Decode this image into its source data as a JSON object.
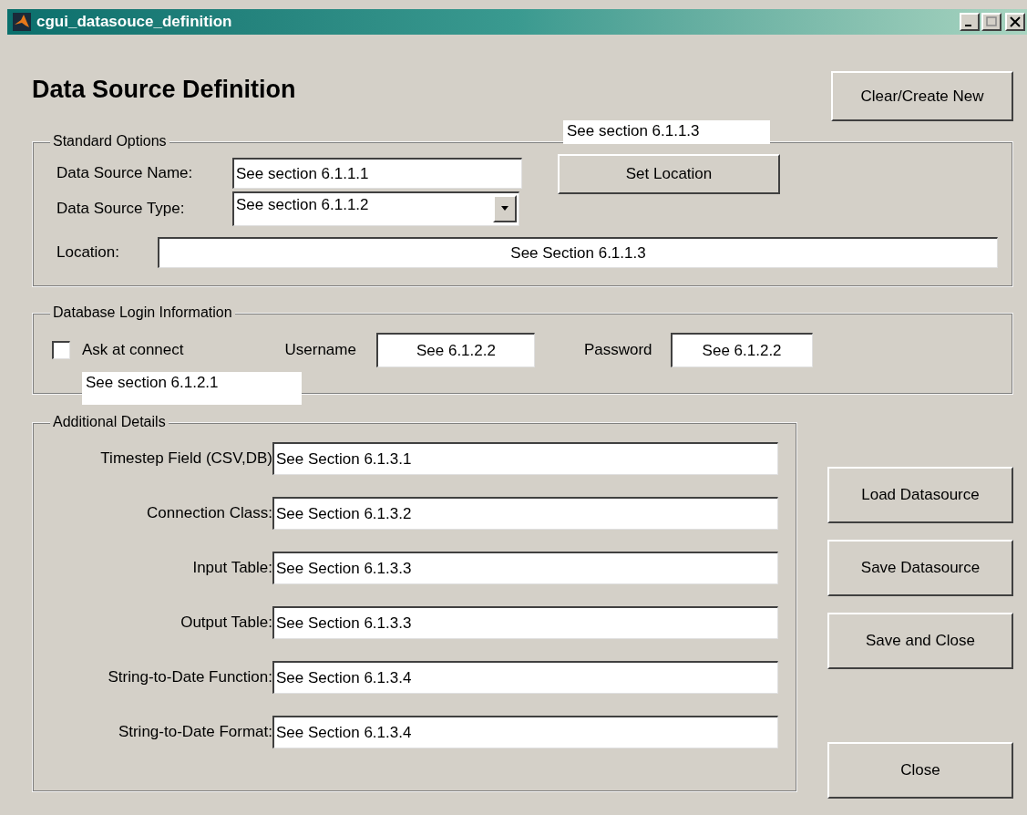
{
  "window": {
    "title": "cgui_datasouce_definition"
  },
  "heading": "Data Source Definition",
  "clear_button": "Clear/Create New",
  "standard_options": {
    "legend": "Standard Options",
    "fields": [
      {
        "kind": "text",
        "label": "Data Source Name:",
        "value": "See section 6.1.1.1"
      },
      {
        "kind": "dropdown",
        "label": "Data Source Type:",
        "value": "See section 6.1.1.2"
      }
    ],
    "set_location_button": "Set Location",
    "location": {
      "label": "Location:",
      "value": "See Section 6.1.1.3"
    }
  },
  "login": {
    "legend": "Database Login Information",
    "ask_at_connect": {
      "label": "Ask at connect",
      "checked": false
    },
    "username": {
      "label": "Username",
      "value": "See 6.1.2.2"
    },
    "password": {
      "label": "Password",
      "value": "See 6.1.2.2"
    }
  },
  "additional": {
    "legend": "Additional Details",
    "fields": [
      {
        "label": "Timestep Field (CSV,DB)",
        "value": "See Section 6.1.3.1"
      },
      {
        "label": "Connection Class:",
        "value": "See Section 6.1.3.2"
      },
      {
        "label": "Input Table:",
        "value": "See Section 6.1.3.3"
      },
      {
        "label": "Output Table:",
        "value": "See Section 6.1.3.3"
      },
      {
        "label": "String-to-Date Function:",
        "value": "See Section 6.1.3.4"
      },
      {
        "label": "String-to-Date Format:",
        "value": "See Section 6.1.3.4"
      }
    ]
  },
  "buttons": [
    {
      "label": "Load Datasource"
    },
    {
      "label": "Save Datasource"
    },
    {
      "label": "Save and Close"
    },
    {
      "label": "Close"
    }
  ],
  "annotations": [
    {
      "text": "See section 6.1.1.3"
    },
    {
      "text": "See section 6.1.2.1"
    }
  ]
}
